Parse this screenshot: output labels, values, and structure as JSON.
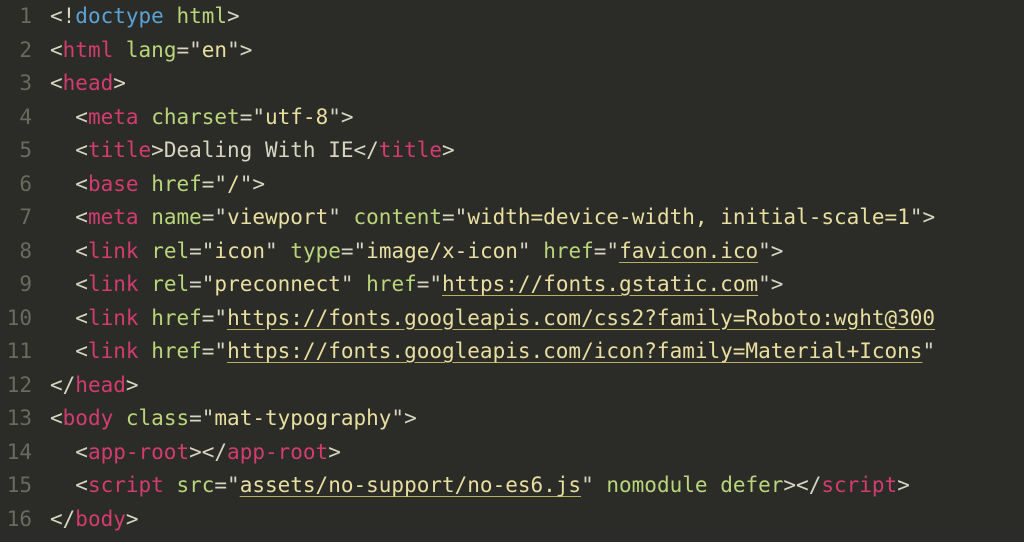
{
  "lines": [
    {
      "num": "1",
      "indent": 0,
      "tokens": [
        {
          "t": "punct",
          "v": "<!"
        },
        {
          "t": "dtype",
          "v": "doctype"
        },
        {
          "t": "punct",
          "v": " "
        },
        {
          "t": "attr",
          "v": "html"
        },
        {
          "t": "punct",
          "v": ">"
        }
      ]
    },
    {
      "num": "2",
      "indent": 0,
      "tokens": [
        {
          "t": "punct",
          "v": "<"
        },
        {
          "t": "tag",
          "v": "html"
        },
        {
          "t": "punct",
          "v": " "
        },
        {
          "t": "attr",
          "v": "lang"
        },
        {
          "t": "punct",
          "v": "=\""
        },
        {
          "t": "string",
          "v": "en"
        },
        {
          "t": "punct",
          "v": "\">"
        }
      ]
    },
    {
      "num": "3",
      "indent": 0,
      "tokens": [
        {
          "t": "punct",
          "v": "<"
        },
        {
          "t": "tag",
          "v": "head"
        },
        {
          "t": "punct",
          "v": ">"
        }
      ]
    },
    {
      "num": "4",
      "indent": 1,
      "tokens": [
        {
          "t": "punct",
          "v": "<"
        },
        {
          "t": "tag",
          "v": "meta"
        },
        {
          "t": "punct",
          "v": " "
        },
        {
          "t": "attr",
          "v": "charset"
        },
        {
          "t": "punct",
          "v": "=\""
        },
        {
          "t": "string",
          "v": "utf-8"
        },
        {
          "t": "punct",
          "v": "\">"
        }
      ]
    },
    {
      "num": "5",
      "indent": 1,
      "tokens": [
        {
          "t": "punct",
          "v": "<"
        },
        {
          "t": "tag",
          "v": "title"
        },
        {
          "t": "punct",
          "v": ">"
        },
        {
          "t": "punct",
          "v": "Dealing With IE"
        },
        {
          "t": "punct",
          "v": "</"
        },
        {
          "t": "tag",
          "v": "title"
        },
        {
          "t": "punct",
          "v": ">"
        }
      ]
    },
    {
      "num": "6",
      "indent": 1,
      "tokens": [
        {
          "t": "punct",
          "v": "<"
        },
        {
          "t": "tag",
          "v": "base"
        },
        {
          "t": "punct",
          "v": " "
        },
        {
          "t": "attr",
          "v": "href"
        },
        {
          "t": "punct",
          "v": "=\""
        },
        {
          "t": "string",
          "v": "/"
        },
        {
          "t": "punct",
          "v": "\">"
        }
      ]
    },
    {
      "num": "7",
      "indent": 1,
      "tokens": [
        {
          "t": "punct",
          "v": "<"
        },
        {
          "t": "tag",
          "v": "meta"
        },
        {
          "t": "punct",
          "v": " "
        },
        {
          "t": "attr",
          "v": "name"
        },
        {
          "t": "punct",
          "v": "=\""
        },
        {
          "t": "string",
          "v": "viewport"
        },
        {
          "t": "punct",
          "v": "\" "
        },
        {
          "t": "attr",
          "v": "content"
        },
        {
          "t": "punct",
          "v": "=\""
        },
        {
          "t": "string",
          "v": "width=device-width, initial-scale=1"
        },
        {
          "t": "punct",
          "v": "\">"
        }
      ]
    },
    {
      "num": "8",
      "indent": 1,
      "tokens": [
        {
          "t": "punct",
          "v": "<"
        },
        {
          "t": "tag",
          "v": "link"
        },
        {
          "t": "punct",
          "v": " "
        },
        {
          "t": "attr",
          "v": "rel"
        },
        {
          "t": "punct",
          "v": "=\""
        },
        {
          "t": "string",
          "v": "icon"
        },
        {
          "t": "punct",
          "v": "\" "
        },
        {
          "t": "attr",
          "v": "type"
        },
        {
          "t": "punct",
          "v": "=\""
        },
        {
          "t": "string",
          "v": "image/x-icon"
        },
        {
          "t": "punct",
          "v": "\" "
        },
        {
          "t": "attr",
          "v": "href"
        },
        {
          "t": "punct",
          "v": "=\""
        },
        {
          "t": "string link",
          "v": "favicon.ico"
        },
        {
          "t": "punct",
          "v": "\">"
        }
      ]
    },
    {
      "num": "9",
      "indent": 1,
      "tokens": [
        {
          "t": "punct",
          "v": "<"
        },
        {
          "t": "tag",
          "v": "link"
        },
        {
          "t": "punct",
          "v": " "
        },
        {
          "t": "attr",
          "v": "rel"
        },
        {
          "t": "punct",
          "v": "=\""
        },
        {
          "t": "string",
          "v": "preconnect"
        },
        {
          "t": "punct",
          "v": "\" "
        },
        {
          "t": "attr",
          "v": "href"
        },
        {
          "t": "punct",
          "v": "=\""
        },
        {
          "t": "string link",
          "v": "https://fonts.gstatic.com"
        },
        {
          "t": "punct",
          "v": "\">"
        }
      ]
    },
    {
      "num": "10",
      "indent": 1,
      "tokens": [
        {
          "t": "punct",
          "v": "<"
        },
        {
          "t": "tag",
          "v": "link"
        },
        {
          "t": "punct",
          "v": " "
        },
        {
          "t": "attr",
          "v": "href"
        },
        {
          "t": "punct",
          "v": "=\""
        },
        {
          "t": "string link",
          "v": "https://fonts.googleapis.com/css2?family=Roboto:wght@300"
        }
      ]
    },
    {
      "num": "11",
      "indent": 1,
      "tokens": [
        {
          "t": "punct",
          "v": "<"
        },
        {
          "t": "tag",
          "v": "link"
        },
        {
          "t": "punct",
          "v": " "
        },
        {
          "t": "attr",
          "v": "href"
        },
        {
          "t": "punct",
          "v": "=\""
        },
        {
          "t": "string link",
          "v": "https://fonts.googleapis.com/icon?family=Material+Icons"
        },
        {
          "t": "punct",
          "v": "\""
        }
      ]
    },
    {
      "num": "12",
      "indent": 0,
      "tokens": [
        {
          "t": "punct",
          "v": "</"
        },
        {
          "t": "tag",
          "v": "head"
        },
        {
          "t": "punct",
          "v": ">"
        }
      ]
    },
    {
      "num": "13",
      "indent": 0,
      "tokens": [
        {
          "t": "punct",
          "v": "<"
        },
        {
          "t": "tag",
          "v": "body"
        },
        {
          "t": "punct",
          "v": " "
        },
        {
          "t": "attr",
          "v": "class"
        },
        {
          "t": "punct",
          "v": "=\""
        },
        {
          "t": "string",
          "v": "mat-typography"
        },
        {
          "t": "punct",
          "v": "\">"
        }
      ]
    },
    {
      "num": "14",
      "indent": 1,
      "tokens": [
        {
          "t": "punct",
          "v": "<"
        },
        {
          "t": "tag",
          "v": "app-root"
        },
        {
          "t": "punct",
          "v": "></"
        },
        {
          "t": "tag",
          "v": "app-root"
        },
        {
          "t": "punct",
          "v": ">"
        }
      ]
    },
    {
      "num": "15",
      "indent": 1,
      "tokens": [
        {
          "t": "punct",
          "v": "<"
        },
        {
          "t": "tag",
          "v": "script"
        },
        {
          "t": "punct",
          "v": " "
        },
        {
          "t": "attr",
          "v": "src"
        },
        {
          "t": "punct",
          "v": "=\""
        },
        {
          "t": "string link",
          "v": "assets/no-support/no-es6.js"
        },
        {
          "t": "punct",
          "v": "\" "
        },
        {
          "t": "attr",
          "v": "nomodule"
        },
        {
          "t": "punct",
          "v": " "
        },
        {
          "t": "attr",
          "v": "defer"
        },
        {
          "t": "punct",
          "v": "></"
        },
        {
          "t": "tag",
          "v": "script"
        },
        {
          "t": "punct",
          "v": ">"
        }
      ]
    },
    {
      "num": "16",
      "indent": 0,
      "tokens": [
        {
          "t": "punct",
          "v": "</"
        },
        {
          "t": "tag",
          "v": "body"
        },
        {
          "t": "punct",
          "v": ">"
        }
      ]
    }
  ],
  "indent_unit": "  "
}
